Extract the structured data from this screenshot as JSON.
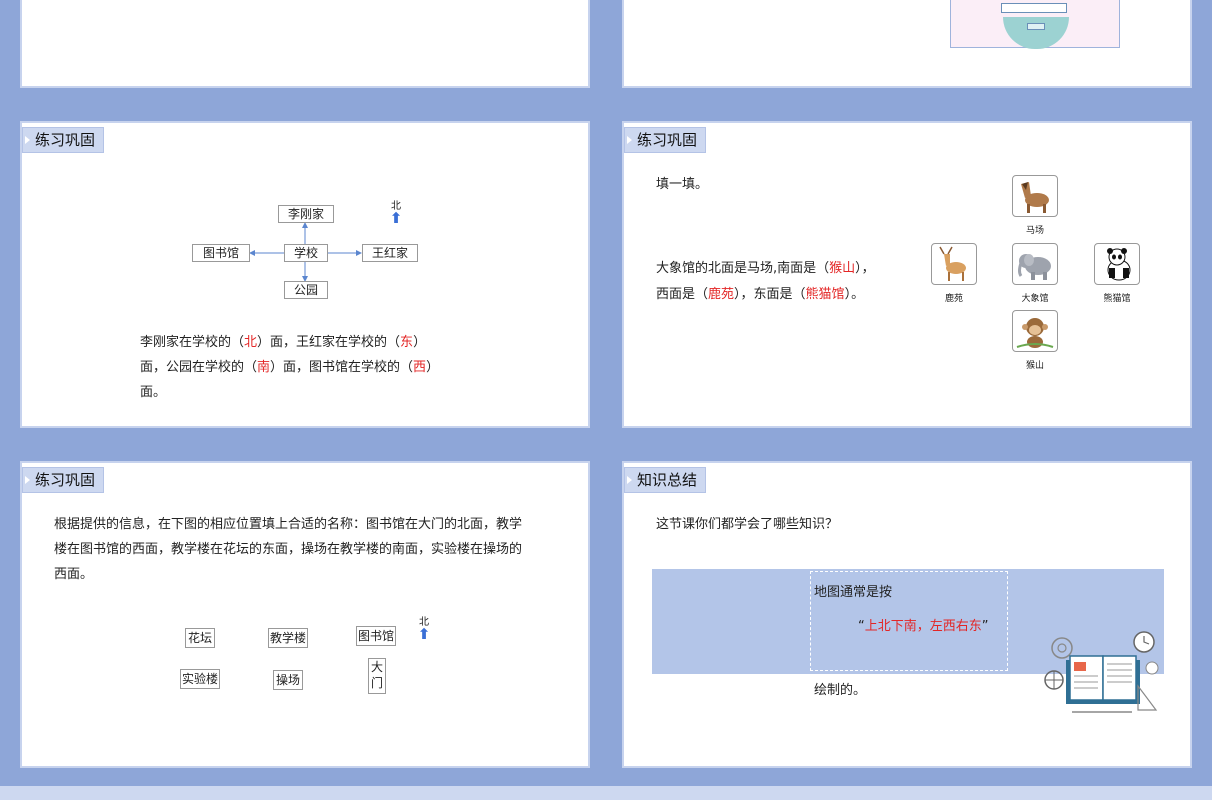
{
  "slides": {
    "s3": {
      "title": "练习巩固",
      "boxes": {
        "north_home": "李刚家",
        "school": "学校",
        "east_home": "王红家",
        "library": "图书馆",
        "park": "公园"
      },
      "north_mark": "北",
      "line1_a": "李刚家在学校的（",
      "ans1": "北",
      "line1_b": "）面，王红家在学校的（",
      "ans2": "东",
      "line1_c": "）",
      "line2_a": "面，公园在学校的（",
      "ans3": "南",
      "line2_b": "）面，图书馆在学校的（",
      "ans4": "西",
      "line2_c": "）",
      "line3": "面。"
    },
    "s4": {
      "title": "练习巩固",
      "intro": "填一填。",
      "line1_a": "大象馆的北面是马场,南面是（",
      "ans1": "猴山",
      "line1_b": "），",
      "line2_a": "西面是（",
      "ans2": "鹿苑",
      "line2_b": "），东面是（",
      "ans3": "熊猫馆",
      "line2_c": "）。",
      "labels": {
        "horse": "马场",
        "deer": "鹿苑",
        "elephant": "大象馆",
        "panda": "熊猫馆",
        "monkey": "猴山"
      }
    },
    "s5": {
      "title": "练习巩固",
      "para1": "根据提供的信息，在下图的相应位置填上合适的名称：图书馆在大门的北面，教学",
      "para2": "楼在图书馆的西面，教学楼在花坛的东面，操场在教学楼的南面，实验楼在操场的",
      "para3": "西面。",
      "boxes": {
        "flower": "花坛",
        "teach": "教学楼",
        "library": "图书馆",
        "lab": "实验楼",
        "field": "操场",
        "gate1": "大",
        "gate2": "门"
      },
      "north_mark": "北"
    },
    "s6": {
      "title": "知识总结",
      "question": "这节课你们都学会了哪些知识？",
      "line1": "地图通常是按",
      "quote_open": "“",
      "highlight": "上北下南，左西右东",
      "quote_close": "”",
      "line3": "绘制的。"
    }
  },
  "colors": {
    "frame": "#8ea6d8",
    "accent_red": "#e32626",
    "band": "#b3c5e8",
    "arrow_blue": "#3a6fd6"
  }
}
